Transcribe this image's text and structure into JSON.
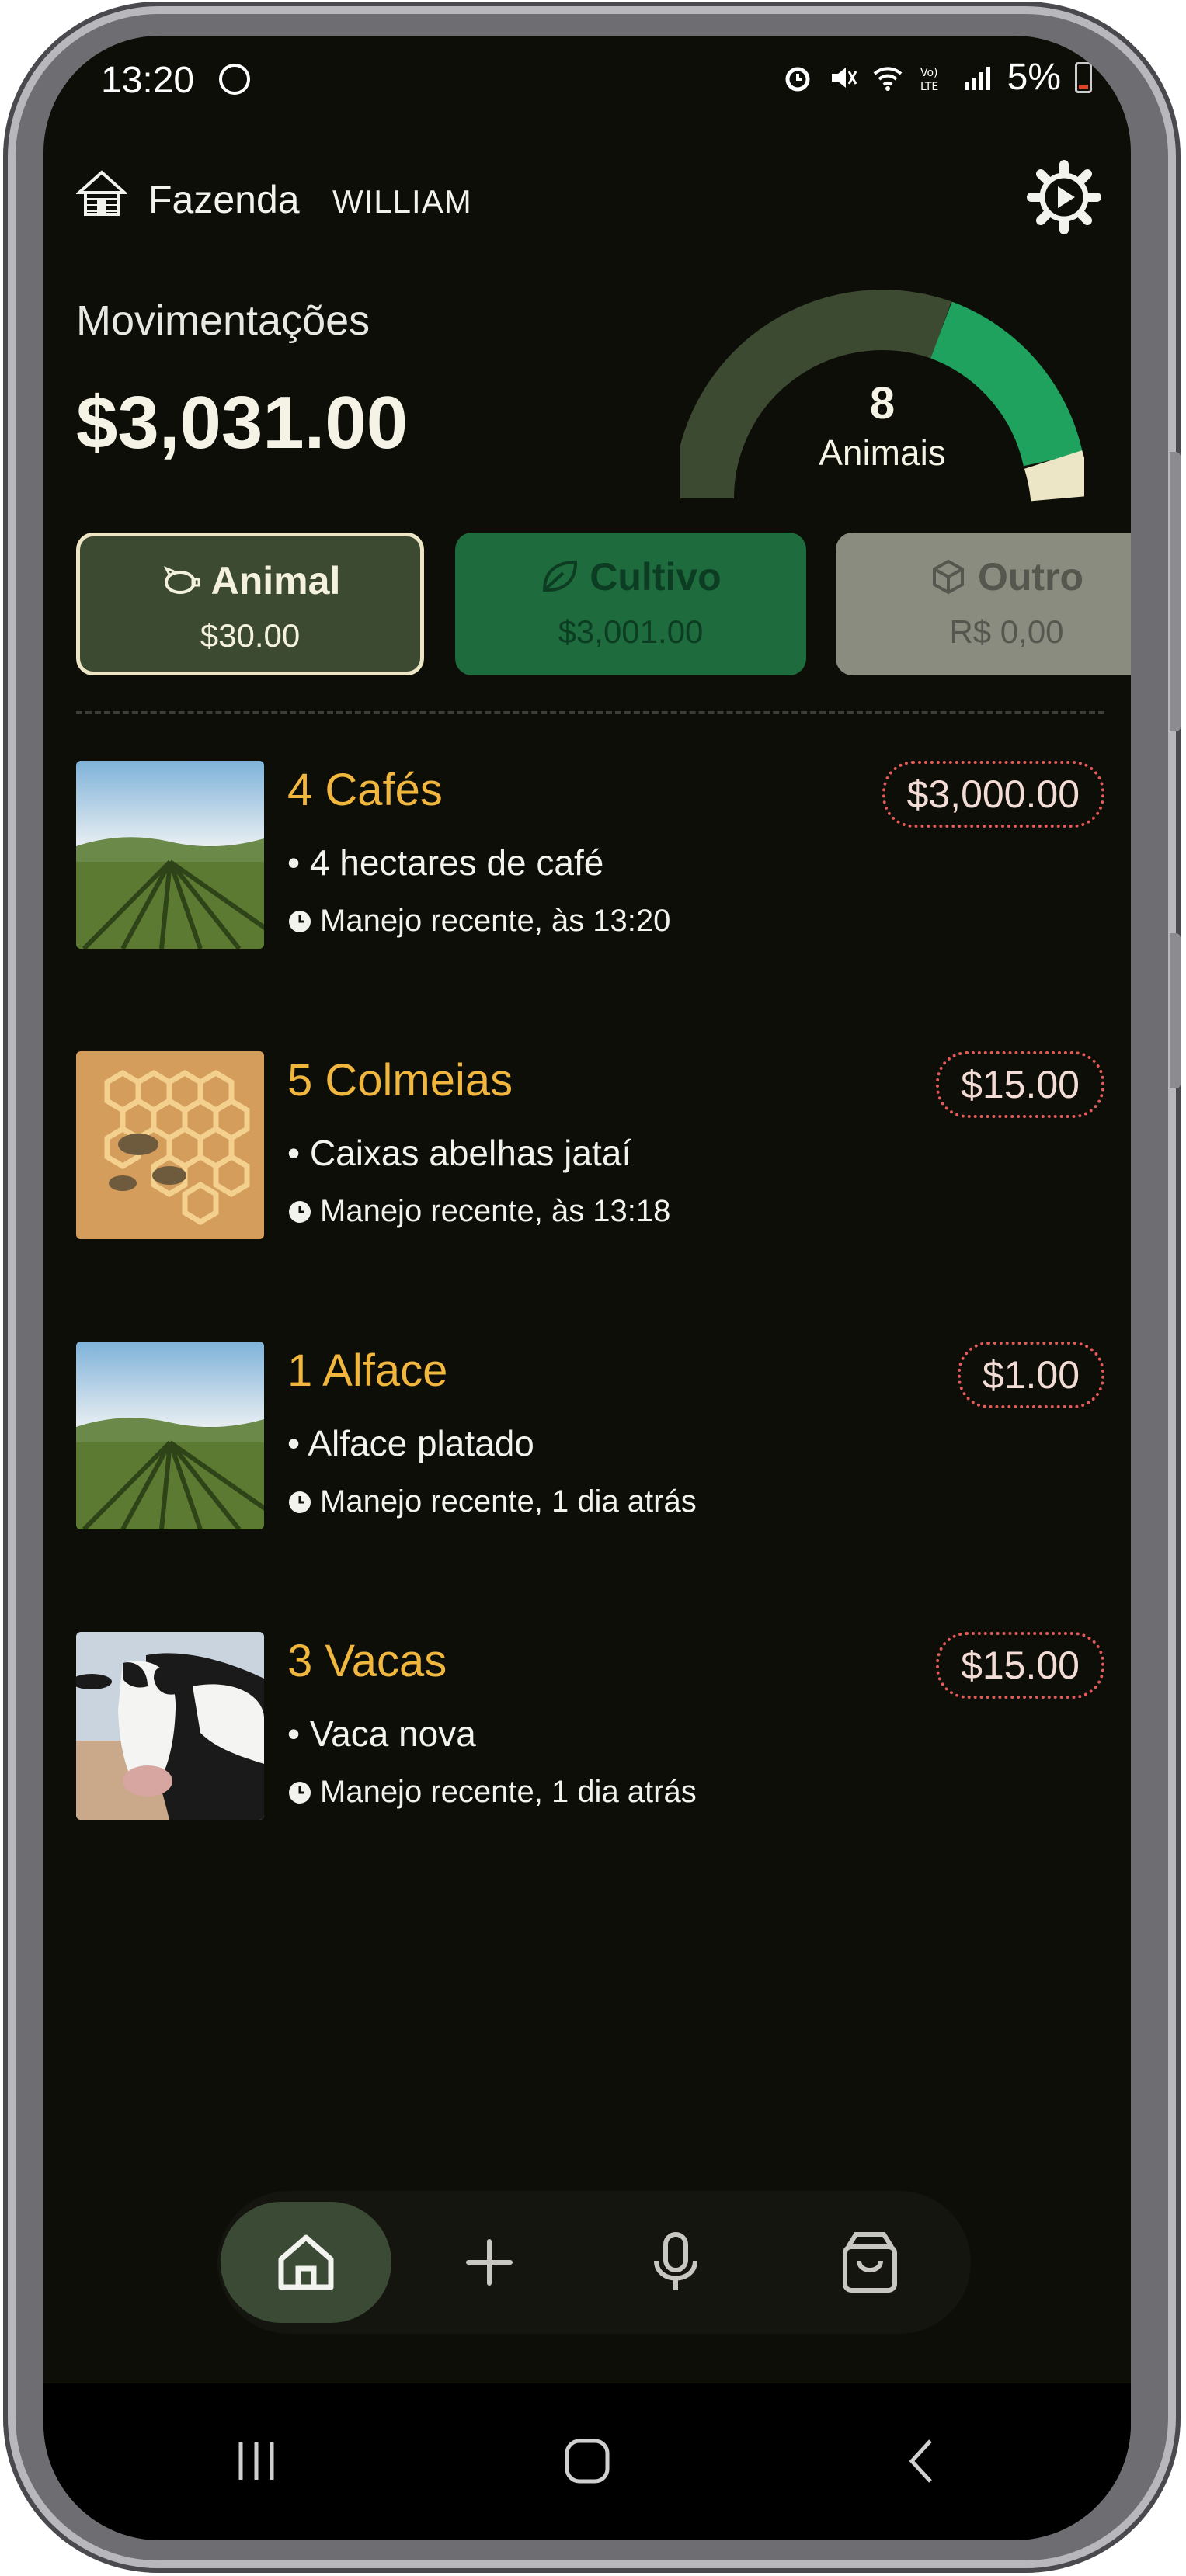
{
  "status_bar": {
    "time": "13:20",
    "battery": "5%"
  },
  "header": {
    "farm_label": "Fazenda",
    "user_name": "WILLIAM"
  },
  "summary": {
    "title": "Movimentações",
    "total": "$3,031.00"
  },
  "gauge": {
    "count": "8",
    "label": "Animais",
    "colors": [
      "#3d4a32",
      "#1fa25e",
      "#ece6c6"
    ]
  },
  "categories": [
    {
      "name": "Animal",
      "value": "$30.00",
      "icon": "pig-icon",
      "selected": true
    },
    {
      "name": "Cultivo",
      "value": "$3,001.00",
      "icon": "leaf-icon",
      "selected": false
    },
    {
      "name": "Outro",
      "value": "R$ 0,00",
      "icon": "box-icon",
      "selected": false
    }
  ],
  "items": [
    {
      "title": "4 Cafés",
      "desc": "• 4 hectares de café",
      "time": "Manejo recente, às 13:20",
      "price": "$3,000.00",
      "image": "field-photo"
    },
    {
      "title": "5 Colmeias",
      "desc": "• Caixas abelhas jataí",
      "time": "Manejo recente, às 13:18",
      "price": "$15.00",
      "image": "honeycomb-photo"
    },
    {
      "title": "1 Alface",
      "desc": "• Alface platado",
      "time": "Manejo recente, 1 dia atrás",
      "price": "$1.00",
      "image": "field-photo"
    },
    {
      "title": "3 Vacas",
      "desc": "• Vaca nova",
      "time": "Manejo recente, 1 dia atrás",
      "price": "$15.00",
      "image": "cow-photo"
    }
  ],
  "nav": [
    "home-icon",
    "add-icon",
    "mic-icon",
    "bag-icon"
  ],
  "colors": {
    "accent_orange": "#f0b63e",
    "price_border": "#e45a5a",
    "background": "#0d0e07"
  }
}
